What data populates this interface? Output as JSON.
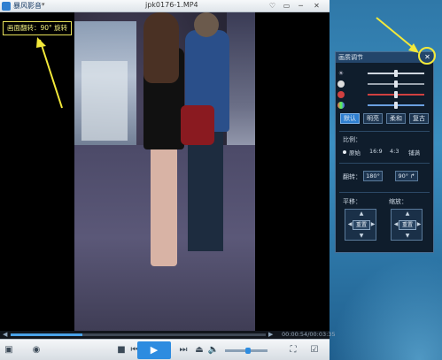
{
  "window": {
    "app_name": "暴风影音",
    "menu_arrow": "▾",
    "file_name": "jpk0176-1.MP4",
    "buttons": {
      "skin": "♡",
      "minimize": "▭",
      "maximize": "─",
      "close": "✕"
    }
  },
  "video": {
    "rotate_notice": "画面翻转：90° 旋转"
  },
  "progress": {
    "fraction": 0.28,
    "left_arrow": "◀",
    "right_arrow": "▶",
    "time": "00:00:54/00:03:35"
  },
  "controls": {
    "list": "▣",
    "eye": "◉",
    "stop": "■",
    "prev": "⏮",
    "play": "▶",
    "next": "⏭",
    "eject": "⏏",
    "volume": "🔈",
    "volume_level": 0.55,
    "fullscreen": "⛶",
    "settings": "☑"
  },
  "panel": {
    "title": "画质调节",
    "close": "✕",
    "sliders": [
      {
        "icon": "☀",
        "value": 0.5,
        "color": "#cfd6df"
      },
      {
        "icon": "",
        "value": 0.5,
        "color": "#9aa3ae"
      },
      {
        "icon": "",
        "value": 0.5,
        "color": "#d04040"
      },
      {
        "icon": "",
        "value": 0.5,
        "color": "#6aa0e0"
      }
    ],
    "presets": {
      "default": "默认",
      "bright": "明亮",
      "soft": "柔和",
      "retro": "复古"
    },
    "ratio": {
      "label": "比例：",
      "original": "原始",
      "r16_9": "16:9",
      "r4_3": "4:3",
      "fill": "铺满"
    },
    "flip": {
      "label": "翻转：",
      "r180": "180°",
      "r90": "90° ↱"
    },
    "pan": {
      "label": "平移：",
      "reset": "重置"
    },
    "zoom": {
      "label": "缩放：",
      "reset": "重置"
    },
    "arrows": {
      "up": "▲",
      "down": "▼",
      "left": "◀",
      "right": "▶"
    }
  },
  "colors": {
    "accent": "#2d8ce0",
    "annotation": "#f3e93a"
  }
}
